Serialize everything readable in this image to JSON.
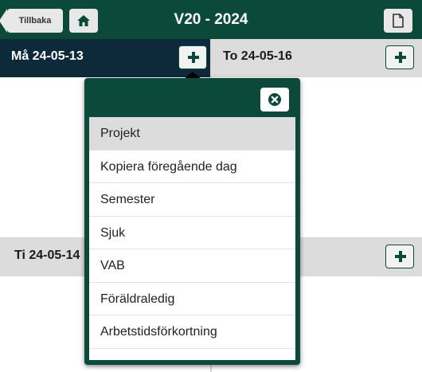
{
  "header": {
    "back_label": "Tillbaka",
    "title": "V20 - 2024",
    "home_icon": "home-icon",
    "copy_icon": "copy-icon"
  },
  "days": {
    "monday": "Må 24-05-13",
    "tuesday": "Ti 24-05-14",
    "thursday": "To 24-05-16"
  },
  "popup": {
    "close_icon": "close-icon",
    "items": [
      {
        "label": "Projekt",
        "active": true
      },
      {
        "label": "Kopiera föregående dag"
      },
      {
        "label": "Semester"
      },
      {
        "label": "Sjuk"
      },
      {
        "label": "VAB"
      },
      {
        "label": "Föräldraledig"
      },
      {
        "label": "Arbetstidsförkortning"
      },
      {
        "label": ""
      }
    ]
  },
  "colors": {
    "brand": "#0b4a3a",
    "selected_day_header": "#0d2a3a",
    "day_header": "#dcdcdc"
  }
}
